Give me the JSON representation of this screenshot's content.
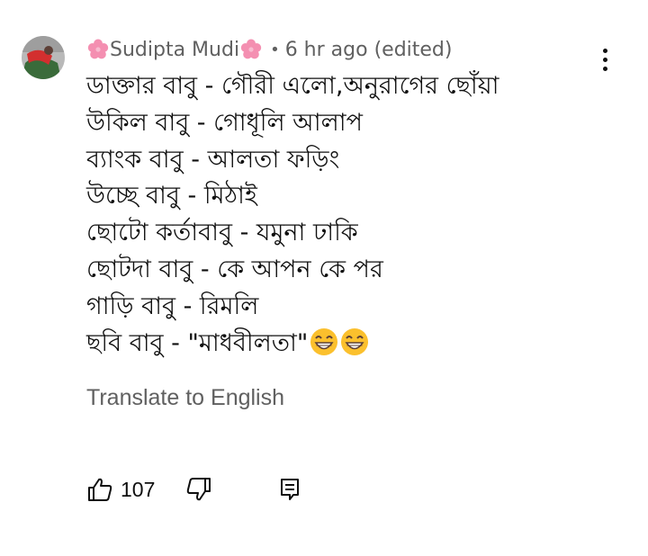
{
  "comment": {
    "author": "Sudipta Mudi",
    "separator": "•",
    "timestamp": "6 hr ago",
    "edited": "(edited)",
    "lines": [
      "ডাক্তার বাবু - গৌরী এলো,অনুরাগের ছোঁয়া",
      "উকিল বাবু - গোধূলি আলাপ",
      "ব্যাংক বাবু - আলতা ফড়িং",
      "উচ্ছে বাবু - মিঠাই",
      "ছোটো কর্তাবাবু - যমুনা ঢাকি",
      "ছোটদা বাবু - কে আপন কে পর",
      "গাড়ি বাবু - রিমলি",
      "ছবি বাবু - \"মাধবীলতা\""
    ],
    "translate_label": "Translate to English",
    "like_count": "107"
  },
  "icons": {
    "author_flower": "cherry-blossom-icon",
    "emoji": "grinning-face-with-smiling-eyes-emoji",
    "like": "thumbs-up-icon",
    "dislike": "thumbs-down-icon",
    "reply": "reply-icon",
    "menu": "more-vert-icon"
  },
  "colors": {
    "text_primary": "#0f0f0f",
    "text_secondary": "#606060",
    "flower_pink": "#f48fb1"
  }
}
